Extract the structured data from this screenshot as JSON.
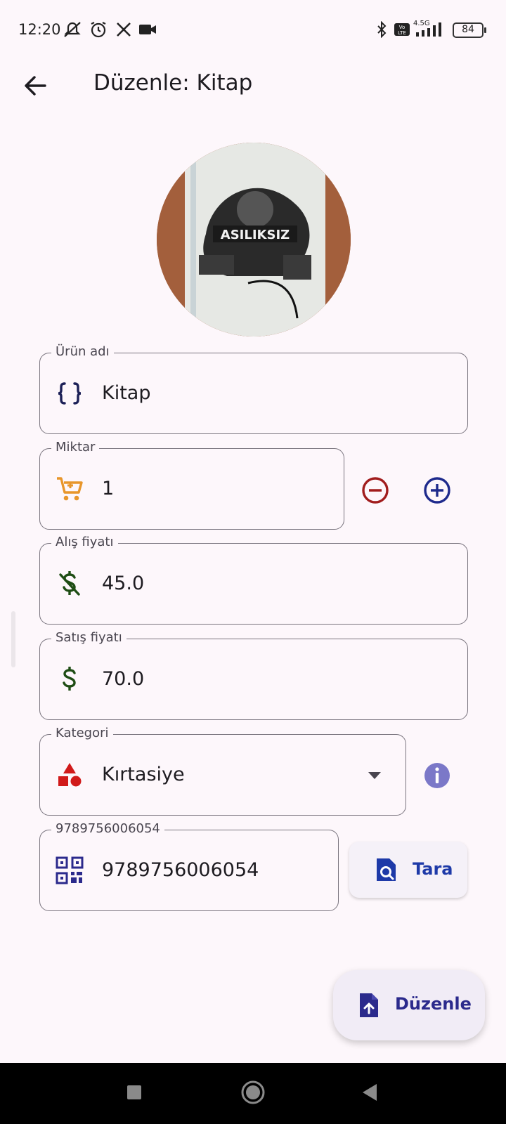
{
  "status_bar": {
    "time": "12:20",
    "battery": "84",
    "network": "4.5G",
    "icons": [
      "mute-notifications-icon",
      "alarm-icon",
      "x-app-icon",
      "video-camera-icon",
      "bluetooth-icon",
      "volte-icon",
      "signal-icon",
      "battery-icon"
    ]
  },
  "app_bar": {
    "title": "Düzenle: Kitap",
    "back_icon": "arrow-left-icon"
  },
  "form": {
    "product_name": {
      "label": "Ürün adı",
      "value": "Kitap",
      "icon": "braces-icon"
    },
    "quantity": {
      "label": "Miktar",
      "value": "1",
      "icon": "cart-icon",
      "decrement_icon": "minus-circle-icon",
      "increment_icon": "plus-circle-icon"
    },
    "purchase_price": {
      "label": "Alış fiyatı",
      "value": "45.0",
      "icon": "dollar-off-icon"
    },
    "sale_price": {
      "label": "Satış fiyatı",
      "value": "70.0",
      "icon": "dollar-icon"
    },
    "category": {
      "label": "Kategori",
      "value": "Kırtasiye",
      "icon": "shapes-icon",
      "info_icon": "info-icon"
    },
    "barcode": {
      "label": "9789756006054",
      "value": "9789756006054",
      "icon": "qr-code-icon"
    }
  },
  "scan_button": {
    "label": "Tara",
    "icon": "document-search-icon"
  },
  "fab": {
    "label": "Düzenle",
    "icon": "file-upload-icon"
  },
  "colors": {
    "background": "#fdf7fb",
    "outline": "#79747e",
    "cart": "#e8962a",
    "dollar": "#1e4d14",
    "minus": "#a11d1d",
    "plus": "#1e2a8c",
    "category_shapes": "#d11a1a",
    "info": "#7b78c8",
    "scan": "#1e3aa8",
    "fab_text": "#2b2a8c"
  }
}
